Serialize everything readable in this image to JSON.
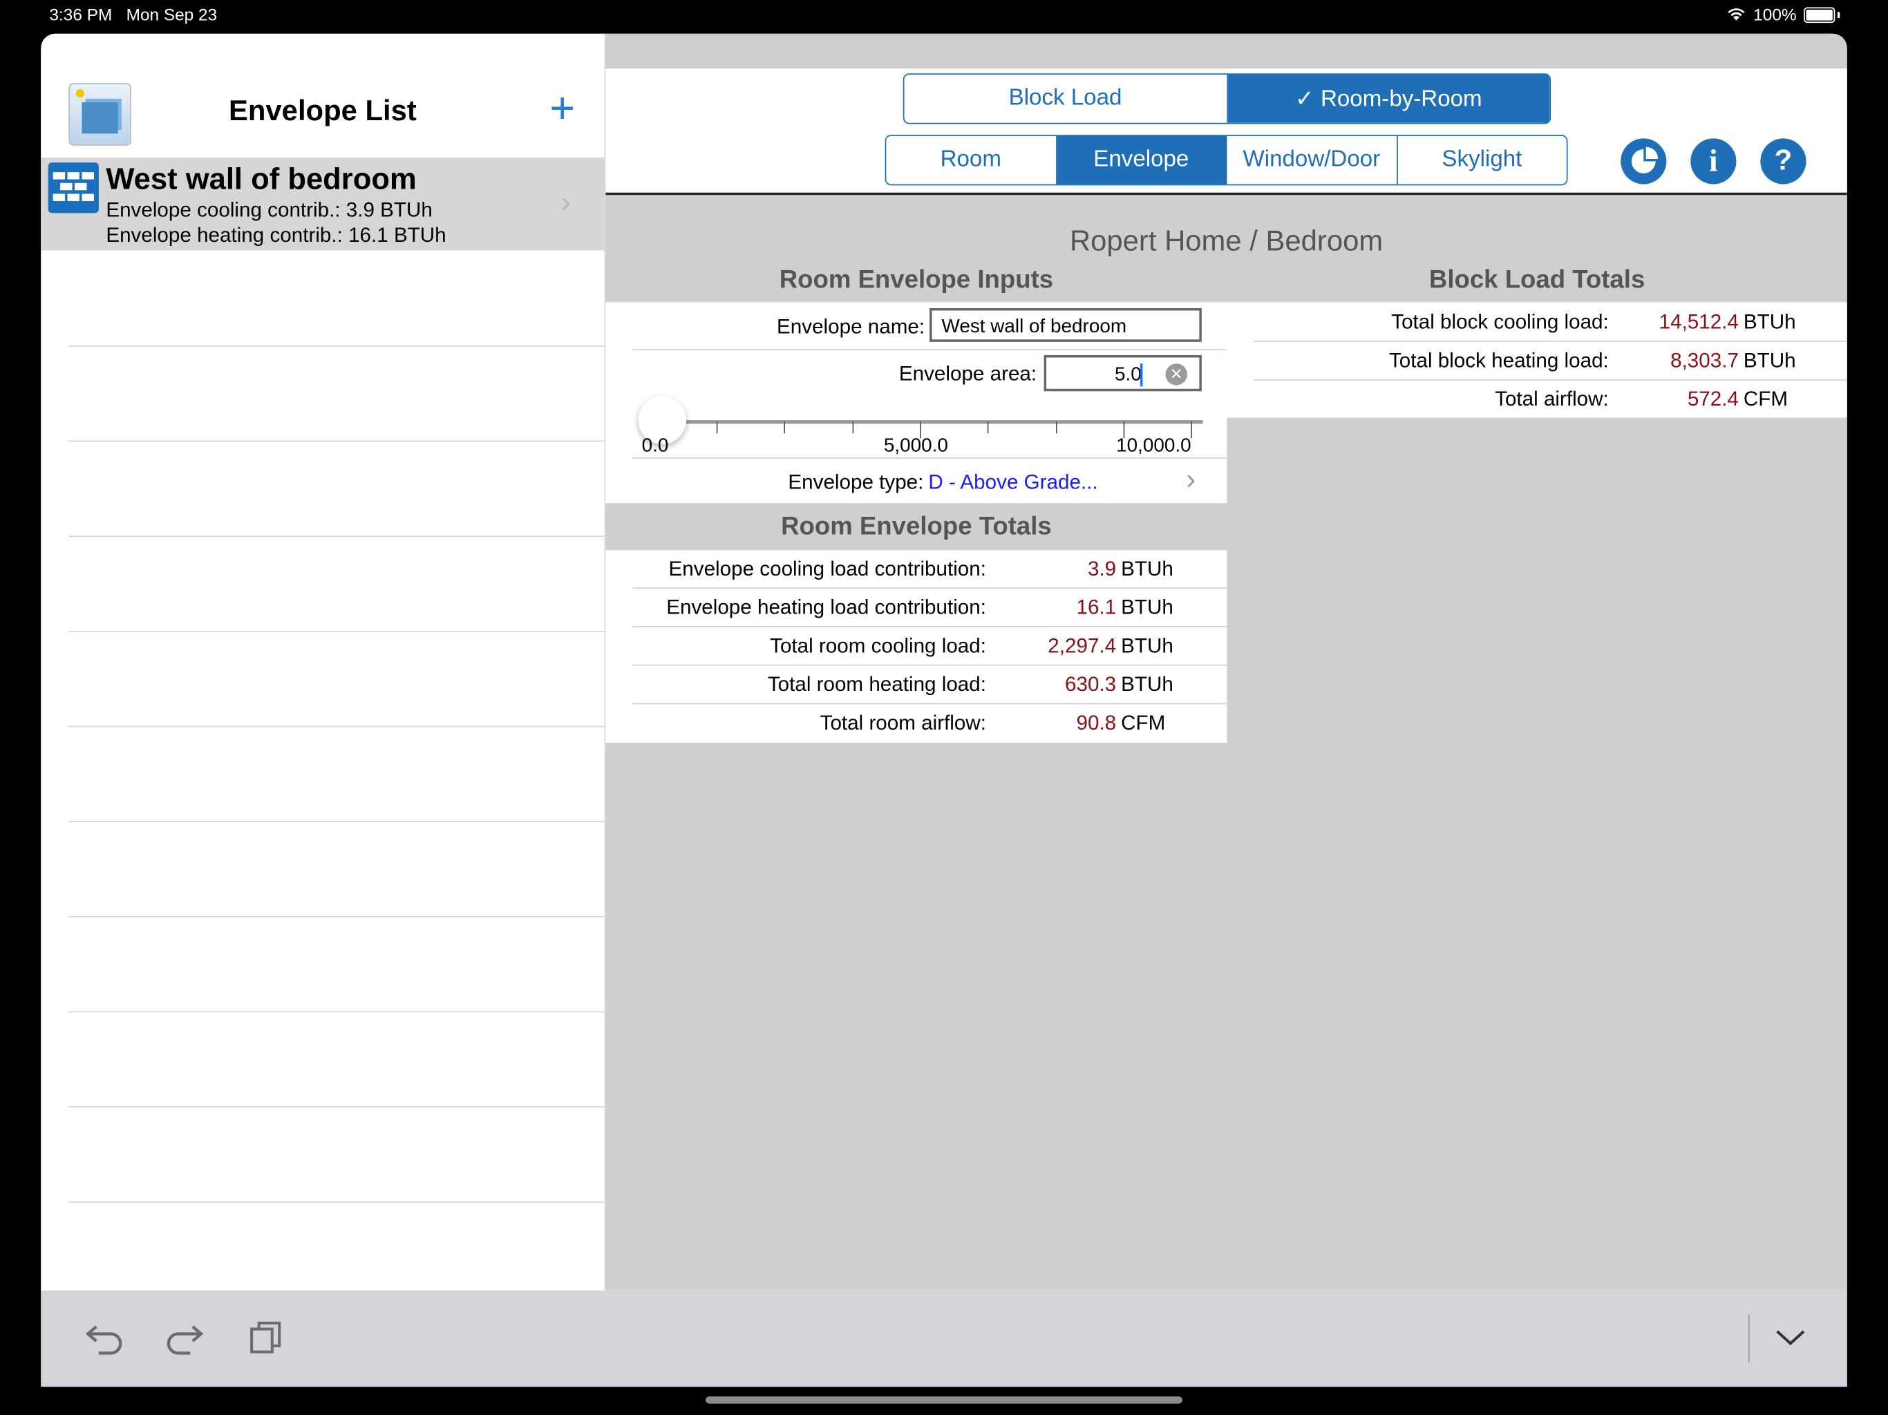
{
  "status_bar": {
    "time": "3:36 PM",
    "date": "Mon Sep 23",
    "battery": "100%"
  },
  "sidebar": {
    "title": "Envelope List",
    "add_label": "+",
    "selected_item": {
      "title": "West wall of bedroom",
      "cooling": "Envelope cooling contrib.: 3.9 BTUh",
      "heating": "Envelope heating contrib.: 16.1 BTUh"
    }
  },
  "mode_tabs": [
    {
      "label": "Block Load",
      "selected": false
    },
    {
      "label": "✓ Room-by-Room",
      "selected": true
    }
  ],
  "section_tabs": [
    {
      "label": "Room",
      "selected": false
    },
    {
      "label": "Envelope",
      "selected": true
    },
    {
      "label": "Window/Door",
      "selected": false
    },
    {
      "label": "Skylight",
      "selected": false
    }
  ],
  "breadcrumb": "Ropert Home / Bedroom",
  "inputs": {
    "title": "Room Envelope Inputs",
    "name_label": "Envelope name:",
    "name_value": "West wall of bedroom",
    "area_label": "Envelope area:",
    "area_value": "5.0",
    "slider": {
      "min_label": "0.0",
      "mid_label": "5,000.0",
      "max_label": "10,000.0",
      "value": 5.0,
      "max": 10000
    },
    "type_label": "Envelope type:",
    "type_value": "D - Above Grade..."
  },
  "room_totals": {
    "title": "Room Envelope Totals",
    "rows": [
      {
        "label": "Envelope cooling load contribution:",
        "value": "3.9",
        "unit": "BTUh"
      },
      {
        "label": "Envelope heating load contribution:",
        "value": "16.1",
        "unit": "BTUh"
      },
      {
        "label": "Total room cooling load:",
        "value": "2,297.4",
        "unit": "BTUh"
      },
      {
        "label": "Total room heating load:",
        "value": "630.3",
        "unit": "BTUh"
      },
      {
        "label": "Total room airflow:",
        "value": "90.8",
        "unit": "CFM"
      }
    ]
  },
  "block_totals": {
    "title": "Block Load Totals",
    "rows": [
      {
        "label": "Total block cooling load:",
        "value": "14,512.4",
        "unit": "BTUh"
      },
      {
        "label": "Total block heating load:",
        "value": "8,303.7",
        "unit": "BTUh"
      },
      {
        "label": "Total airflow:",
        "value": "572.4",
        "unit": "CFM"
      }
    ]
  },
  "colors": {
    "accent": "#1f6fb8",
    "value_red": "#8a0f16",
    "link_blue": "#1a1aff"
  }
}
